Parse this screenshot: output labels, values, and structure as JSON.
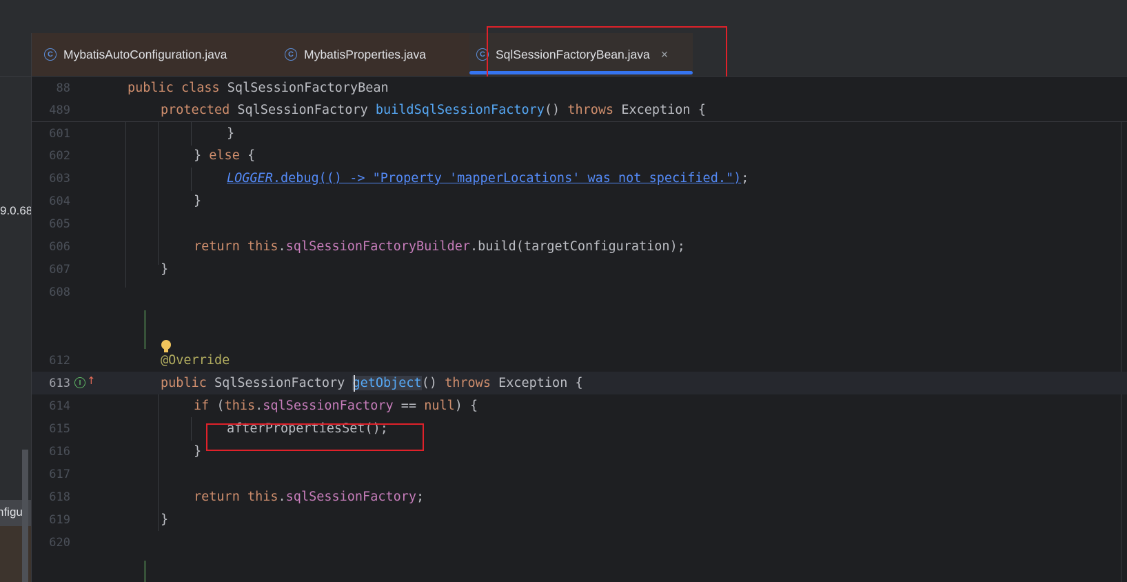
{
  "left_panel": {
    "fragment_1": "9.0.68",
    "fragment_2": "nfigur"
  },
  "tabs": [
    {
      "label": "MybatisAutoConfiguration.java",
      "icon": "class-icon",
      "active": false
    },
    {
      "label": "MybatisProperties.java",
      "icon": "class-icon",
      "active": false
    },
    {
      "label": "SqlSessionFactoryBean.java",
      "icon": "class-icon",
      "active": true,
      "close": "×"
    }
  ],
  "tab_icon_glyph": "C",
  "editor": {
    "sticky": [
      {
        "num": "88",
        "tokens": [
          [
            "kw",
            "public "
          ],
          [
            "kw",
            "class "
          ],
          [
            "plain",
            "SqlSessionFactoryBean"
          ]
        ]
      },
      {
        "num": "489",
        "tokens": [
          [
            "kw",
            "protected "
          ],
          [
            "plain",
            "SqlSessionFactory "
          ],
          [
            "fn",
            "buildSqlSessionFactory"
          ],
          [
            "plain",
            "() "
          ],
          [
            "kw",
            "throws "
          ],
          [
            "plain",
            "Exception {"
          ]
        ]
      }
    ],
    "lines": [
      {
        "num": "601",
        "tokens": [
          [
            "plain",
            "}"
          ]
        ]
      },
      {
        "num": "602",
        "tokens": [
          [
            "plain",
            "} "
          ],
          [
            "kw",
            "else "
          ],
          [
            "plain",
            "{"
          ]
        ]
      },
      {
        "num": "603",
        "tokens": [
          [
            "italic-field",
            "LOGGER"
          ],
          [
            "link",
            ".debug(() -> \"Property 'mapperLocations' was not specified.\")"
          ],
          [
            "plain",
            ";"
          ]
        ]
      },
      {
        "num": "604",
        "tokens": [
          [
            "plain",
            "}"
          ]
        ]
      },
      {
        "num": "605",
        "tokens": []
      },
      {
        "num": "606",
        "tokens": [
          [
            "kw",
            "return "
          ],
          [
            "kw",
            "this"
          ],
          [
            "plain",
            "."
          ],
          [
            "fld",
            "sqlSessionFactoryBuilder"
          ],
          [
            "plain",
            ".build(targetConfiguration);"
          ]
        ]
      },
      {
        "num": "607",
        "tokens": [
          [
            "plain",
            "}"
          ]
        ]
      },
      {
        "num": "608",
        "tokens": []
      },
      {
        "num": "612",
        "tokens": [
          [
            "ann",
            "@Override"
          ]
        ]
      },
      {
        "num": "613",
        "tokens": [
          [
            "kw",
            "public "
          ],
          [
            "plain",
            "SqlSessionFactory "
          ],
          [
            "fn-hl",
            "getObject"
          ],
          [
            "plain",
            "() "
          ],
          [
            "kw",
            "throws "
          ],
          [
            "plain",
            "Exception {"
          ]
        ]
      },
      {
        "num": "614",
        "tokens": [
          [
            "kw",
            "if "
          ],
          [
            "plain",
            "("
          ],
          [
            "kw",
            "this"
          ],
          [
            "plain",
            "."
          ],
          [
            "fld",
            "sqlSessionFactory"
          ],
          [
            "plain",
            " == "
          ],
          [
            "kw",
            "null"
          ],
          [
            "plain",
            ") {"
          ]
        ]
      },
      {
        "num": "615",
        "tokens": [
          [
            "plain",
            "afterPropertiesSet();"
          ]
        ]
      },
      {
        "num": "616",
        "tokens": [
          [
            "plain",
            "}"
          ]
        ]
      },
      {
        "num": "617",
        "tokens": []
      },
      {
        "num": "618",
        "tokens": [
          [
            "kw",
            "return "
          ],
          [
            "kw",
            "this"
          ],
          [
            "plain",
            "."
          ],
          [
            "fld",
            "sqlSessionFactory"
          ],
          [
            "plain",
            ";"
          ]
        ]
      },
      {
        "num": "619",
        "tokens": [
          [
            "plain",
            "}"
          ]
        ]
      },
      {
        "num": "620",
        "tokens": []
      }
    ],
    "gutter_icon_613": "implements-icon",
    "gutter_arrow_613": "↑",
    "gutter_glyph_613": "I"
  },
  "colors": {
    "keyword": "#cf8e6d",
    "method": "#56a8f5",
    "field": "#c77dbb",
    "annotation": "#b3ae60",
    "highlight_box": "#e0212a",
    "active_tab_underline": "#3574f0"
  }
}
